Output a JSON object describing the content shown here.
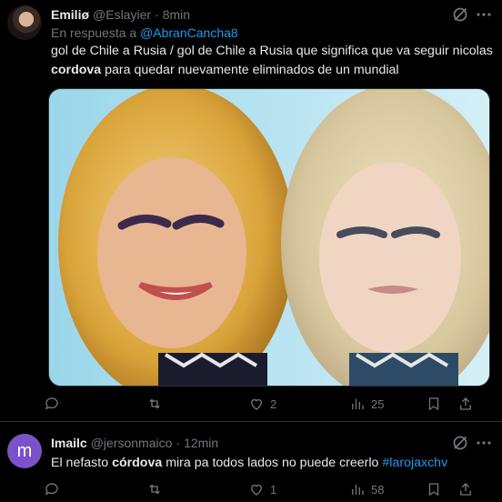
{
  "tweets": [
    {
      "author": {
        "name": "Emiliø",
        "handle": "@Eslayier",
        "time": "8min",
        "avatar_icon": "user-avatar-photo"
      },
      "reply_prefix": "En respuesta a",
      "reply_to": "@AbranCancha8",
      "text": {
        "line1": "gol de Chile a Rusia / gol de Chile a Rusia que significa que va seguir nicolas",
        "bold": "cordova",
        "rest": "para quedar nuevamente eliminados de un mundial"
      },
      "media_alt": "",
      "actions": {
        "reply": "",
        "retweet": "",
        "like": "2",
        "views": "25"
      }
    },
    {
      "author": {
        "name": "Imailc",
        "handle": "@jersonmaico",
        "time": "12min",
        "avatar_letter": "m"
      },
      "text": {
        "pre": "El nefasto",
        "bold": "córdova",
        "post": " mira pa todos lados no puede creerlo",
        "hashtag": "#larojaxchv"
      },
      "actions": {
        "reply": "",
        "retweet": "",
        "like": "1",
        "views": "58"
      }
    }
  ],
  "colors": {
    "background": "#000000",
    "text": "#e7e9ea",
    "muted": "#71767b",
    "link": "#1d9bf0",
    "avatar2": "#7b52c9"
  },
  "icons": [
    "grok-icon",
    "more-icon",
    "reply-icon",
    "retweet-icon",
    "like-icon",
    "views-icon",
    "bookmark-icon",
    "share-icon"
  ]
}
